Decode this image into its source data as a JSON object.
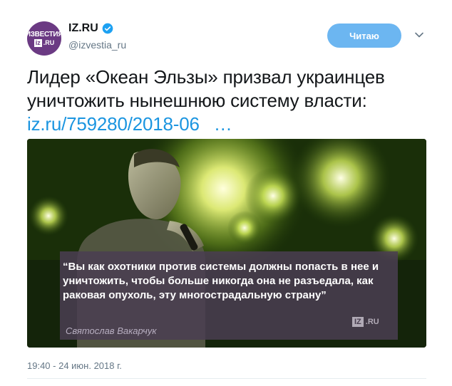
{
  "account": {
    "avatar_top": "ИЗВЕСТИЯ",
    "avatar_iz": "iz",
    "avatar_ru": ".RU",
    "display_name": "IZ.RU",
    "handle": "@izvestia_ru"
  },
  "follow_button": {
    "label": "Читаю"
  },
  "tweet": {
    "text": "Лидер «Океан Эльзы» призвал украинцев уничтожить нынешнюю систему власти: ",
    "link": "iz.ru/759280/2018-06",
    "link_ellipsis": "…",
    "timestamp": "19:40 - 24 июн. 2018 г."
  },
  "media": {
    "quote": "“Вы как охотники против системы должны попасть в нее и уничтожить, чтобы больше никогда она не разъедала, как раковая опухоль, эту многострадальную страну”",
    "author": "Святослав Вакарчук",
    "watermark_iz": "IZ",
    "watermark_ru": ".RU"
  },
  "colors": {
    "link": "#1b95e0",
    "follow_button": "#6cb6f1",
    "avatar": "#6b3a83",
    "verified": "#1da1f2"
  }
}
